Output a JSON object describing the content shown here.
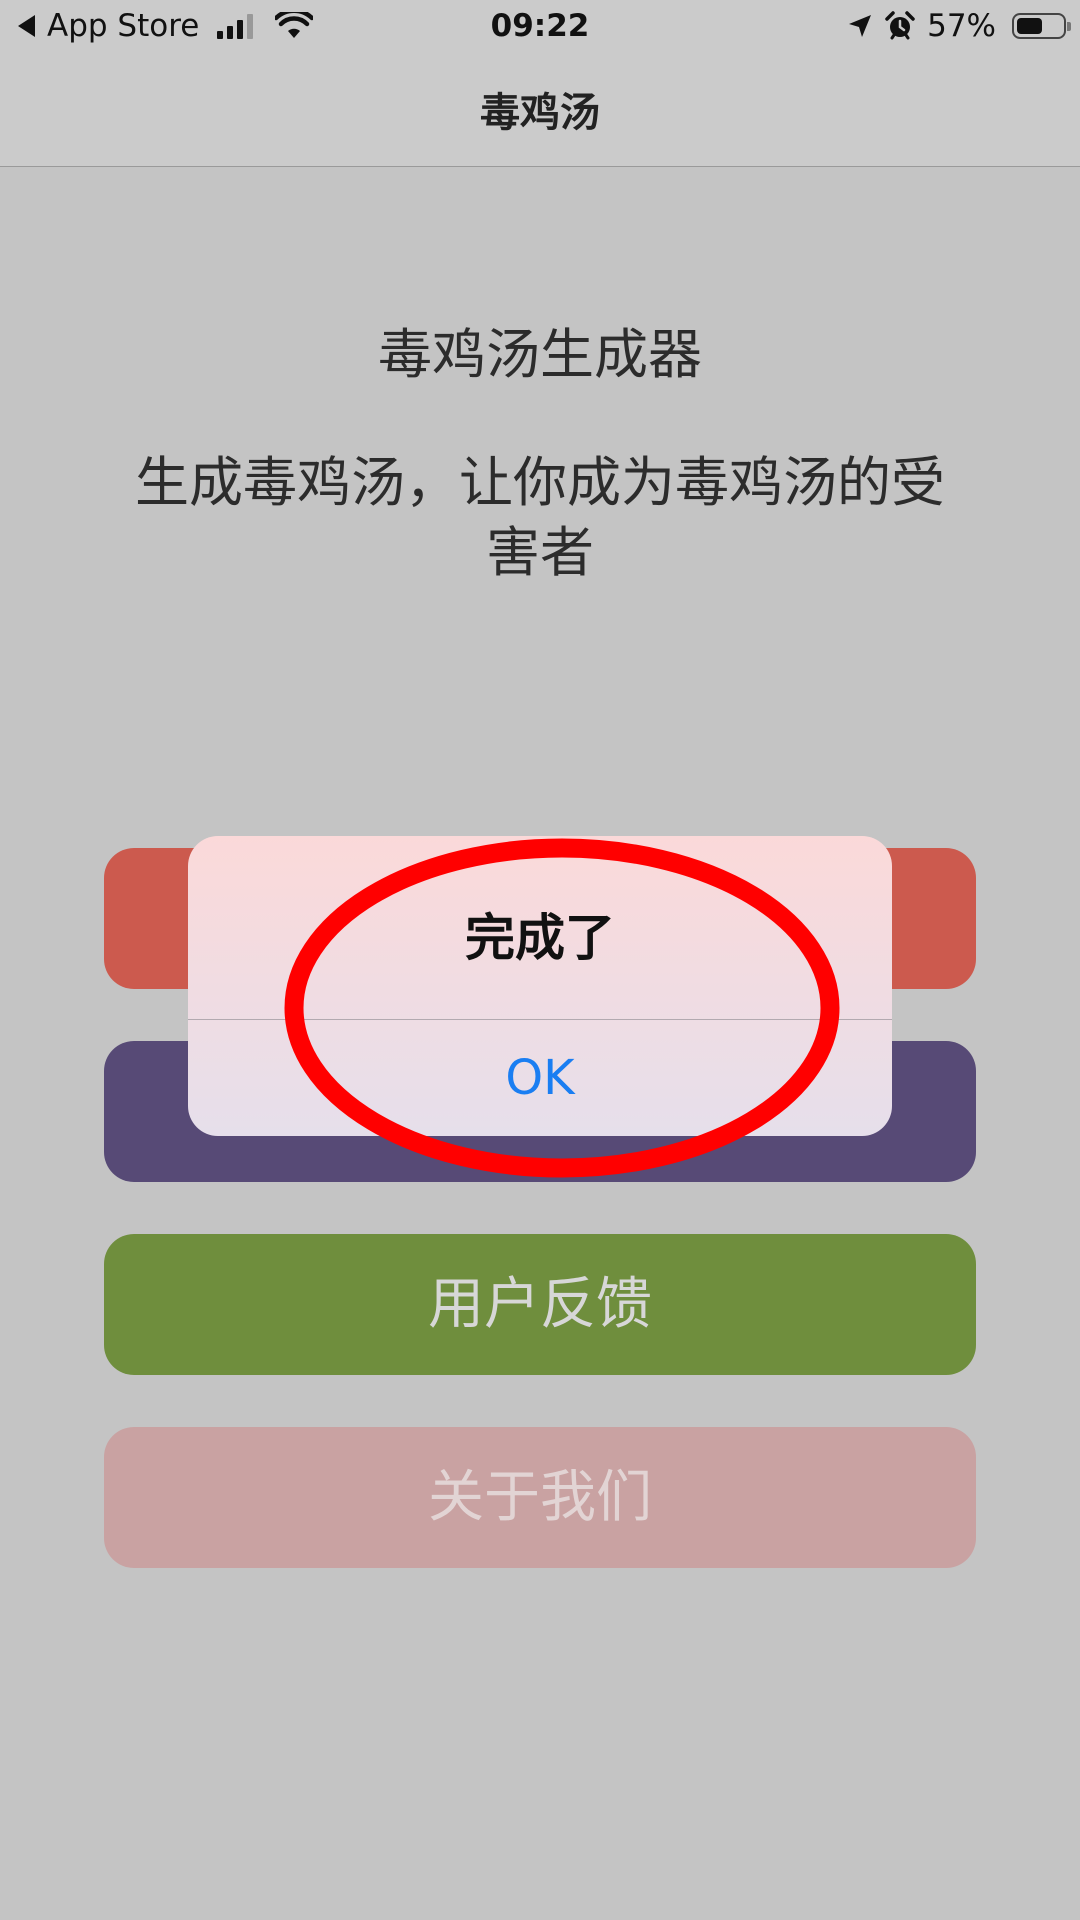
{
  "status_bar": {
    "back_label": "App Store",
    "time": "09:22",
    "battery_percent_text": "57%",
    "battery_level": 0.57,
    "signal_bars_active": 3,
    "signal_bars_total": 4,
    "icons": [
      "back-caret-icon",
      "cellular-signal-icon",
      "wifi-icon",
      "location-arrow-icon",
      "alarm-icon",
      "battery-icon"
    ]
  },
  "nav": {
    "title": "毒鸡汤"
  },
  "main": {
    "title": "毒鸡汤生成器",
    "subtitle": "生成毒鸡汤，让你成为毒鸡汤的受害者",
    "buttons": [
      {
        "label": "",
        "color": "#cc5a4e"
      },
      {
        "label": "",
        "color": "#574a76"
      },
      {
        "label": "用户反馈",
        "color": "#6f8e3d"
      },
      {
        "label": "关于我们",
        "color": "#c9a2a2"
      }
    ]
  },
  "alert": {
    "title": "完成了",
    "ok_label": "OK",
    "ok_color": "#1a7ef2"
  },
  "annotation": {
    "shape": "ellipse",
    "color": "#ff0000"
  }
}
